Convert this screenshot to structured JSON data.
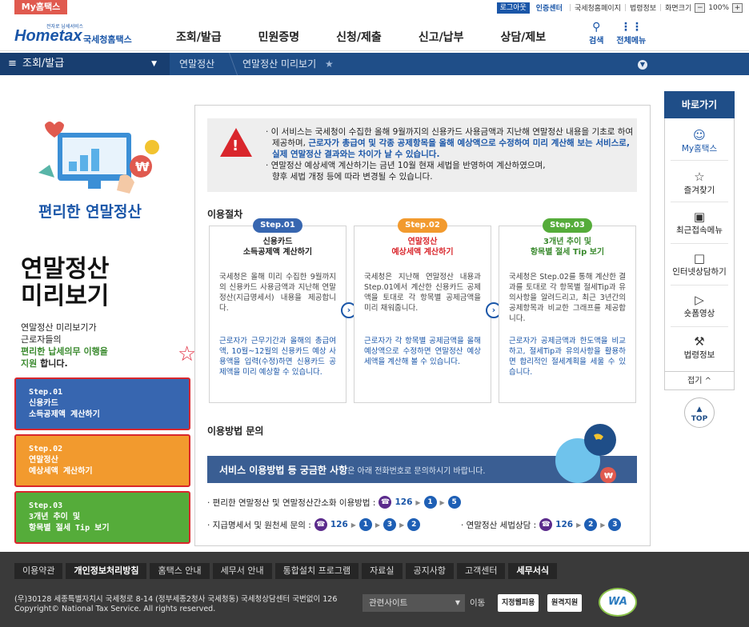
{
  "topbar": {
    "my_tab": "My홈택스",
    "logout": "로그아웃",
    "cert_center": "인증센터",
    "homepage_link": "국세청홈페이지",
    "law_link": "법령정보",
    "screen_size_label": "화면크기",
    "zoom_minus": "−",
    "zoom_value": "100%",
    "zoom_plus": "+"
  },
  "header": {
    "logo_main": "Hometax",
    "logo_tiny": "전자로 납세서비스",
    "logo_sub": "국세청홈택스",
    "nav": [
      "조회/발급",
      "민원증명",
      "신청/제출",
      "신고/납부",
      "상담/제보"
    ],
    "search_label": "검색",
    "allmenu_label": "전체메뉴"
  },
  "breadcrumb": {
    "menu_label": "조회/발급",
    "item1": "연말정산",
    "item2": "연말정산 미리보기",
    "star": "★"
  },
  "left": {
    "tagline": "편리한 연말정산",
    "title_line1": "연말정산",
    "title_line2": "미리보기",
    "desc_line1": "연말정산 미리보기가",
    "desc_line2": "근로자들의",
    "desc_hl1": "편리한 납세의무 이행을",
    "desc_hl2": "지원",
    "desc_end": " 합니다.",
    "steps": [
      {
        "l1": "Step.01",
        "l2": "신용카드",
        "l3": "소득공제액 계산하기"
      },
      {
        "l1": "Step.02",
        "l2": "연말정산",
        "l3": "예상세액 계산하기"
      },
      {
        "l1": "Step.03",
        "l2": "3개년 추이 및",
        "l3": "항목별 절세 Tip 보기"
      }
    ]
  },
  "notice": {
    "line1": "· 이 서비스는 국세청이 수집한 올해 9월까지의 신용카드 사용금액과 지난해 연말정산 내용을 기초로 하여",
    "line2a": "제공하며, ",
    "line2b": "근로자가 총급여 및 각종 공제항목을 올해 예상액으로 수정하여 미리 계산해 보는 서비스로,",
    "line3": "실제 연말정산 결과와는 차이가 날 수 있습니다.",
    "line4": "· 연말정산 예상세액 계산하기는 금년 10월 현재 세법을 반영하여 계산하였으며,",
    "line5": "향후 세법 개정 등에 따라 변경될 수 있습니다."
  },
  "procedure": {
    "title": "이용절차",
    "steps": [
      {
        "pill": "Step.01",
        "head1": "신용카드",
        "head2": "소득공제액 계산하기",
        "body": "국세청은 올해 미리 수집한 9월까지의 신용카드 사용금액과 지난해 연말정산(지급명세서) 내용을 제공합니다.",
        "note": "근로자가 근무기간과 올해의 총급여액, 10월~12월의 신용카드 예상 사용액을 입력(수정)하면 신용카드 공제액을 미리 예상할 수 있습니다."
      },
      {
        "pill": "Step.02",
        "head1": "연말정산",
        "head2": "예상세액 계산하기",
        "body": "국세청은 지난해 연말정산 내용과 Step.01에서 계산한 신용카드 공제액을 토대로 각 항목별 공제금액을 미리 채워줍니다.",
        "note": "근로자가 각 항목별 공제금액을 올해예상액으로 수정하면 연말정산 예상세액을 계산해 볼 수 있습니다."
      },
      {
        "pill": "Step.03",
        "head1": "3개년 추이 및",
        "head2": "항목별 절세 Tip 보기",
        "body": "국세청은 Step.02를 통해 계산한 결과를 토대로 각 항목별 절세Tip과 유의사항을 알려드리고, 최근 3년간의 공제항목과 비교한 그래프를 제공합니다.",
        "note": "근로자가 공제금액과 한도액을 비교하고, 절세Tip과 유의사항을 활용하면 합리적인 절세계획을 세울 수 있습니다."
      }
    ]
  },
  "contact": {
    "title": "이용방법 문의",
    "banner_bold": "서비스 이용방법 등 궁금한 사항",
    "banner_rest": "은 아래 전화번호로 문의하시기 바랍니다.",
    "line1_label": "· 편리한 연말정산 및 연말정산간소화 이용방법 :",
    "line1_num": "126",
    "line1_seq": [
      "1",
      "5"
    ],
    "line2_label": "· 지급명세서 및 원천세 문의 :",
    "line2_num": "126",
    "line2_seq": [
      "1",
      "3",
      "2"
    ],
    "line3_label": "· 연말정산 세법상담 :",
    "line3_num": "126",
    "line3_seq": [
      "2",
      "3"
    ]
  },
  "quick": {
    "title": "바로가기",
    "items": [
      "My홈택스",
      "즐겨찾기",
      "최근접속메뉴",
      "인터넷상담하기",
      "숏폼영상",
      "법령정보"
    ],
    "fold": "접기 ^",
    "top": "TOP"
  },
  "footer": {
    "links": [
      "이용약관",
      "개인정보처리방침",
      "홈택스 안내",
      "세무서 안내",
      "통합설치 프로그램",
      "자료실",
      "공지사항",
      "고객센터",
      "세무서식"
    ],
    "addr1": "(우)30128 세종특별자치시 국세청로 8-14 (정부세종2청사 국세청동) 국세청상담센터 국번없이 126",
    "addr2": "Copyright© National Tax Service. All rights reserved.",
    "related": "관련사이트",
    "go": "이동",
    "badge1": "지정웹피용",
    "badge2": "원격지원",
    "wa": "WA"
  },
  "colors": {
    "primary_blue": "#1f4e88",
    "step1": "#3766b0",
    "step2": "#f29a2e",
    "step3": "#55ac3a",
    "alert_red": "#d9262c"
  }
}
